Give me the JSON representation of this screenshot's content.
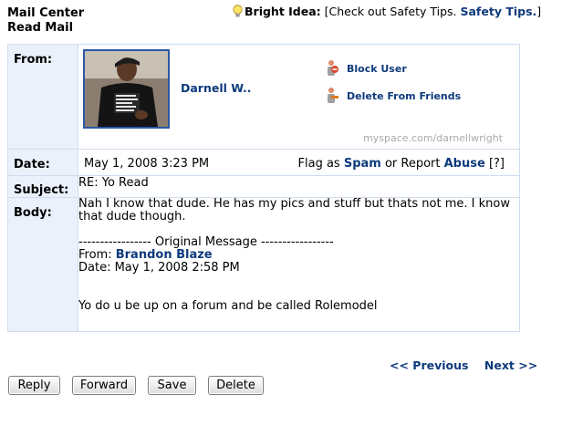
{
  "header": {
    "line1": "Mail Center",
    "line2": "Read Mail"
  },
  "bright_idea": {
    "label": "Bright Idea:",
    "text_prefix": "[Check out Safety Tips. ",
    "link": "Safety Tips.",
    "text_suffix": "]"
  },
  "labels": {
    "from": "From:",
    "date": "Date:",
    "subject": "Subject:",
    "body": "Body:"
  },
  "sender": {
    "name": "Darnell W..",
    "url": "myspace.com/darnellwright",
    "shirt_text": "I DON'T HAVE A WORKING PROBLEM I DRINK I GET DRUNK I FALL DOWN NO PROBLEM"
  },
  "actions": {
    "block": "Block User",
    "delete_friend": "Delete From Friends"
  },
  "date": "May 1, 2008 3:23 PM",
  "flag": {
    "prefix": "Flag as ",
    "spam": "Spam",
    "mid": " or Report ",
    "abuse": "Abuse",
    "help": " [?]"
  },
  "subject": "RE: Yo Read",
  "body": {
    "reply_line1": "Nah I know that dude. He has my pics and stuff but thats not me. I know",
    "reply_line2": "that dude though.",
    "separator": "----------------- Original Message -----------------",
    "orig_from_label": "From: ",
    "orig_from_name": "Brandon Blaze",
    "orig_date": "Date: May 1, 2008 2:58 PM",
    "orig_text": "Yo do u be up on a forum and be called Rolemodel"
  },
  "pager": {
    "previous": "<< Previous",
    "next": "Next >>"
  },
  "buttons": {
    "reply": "Reply",
    "forward": "Forward",
    "save": "Save",
    "delete": "Delete"
  }
}
